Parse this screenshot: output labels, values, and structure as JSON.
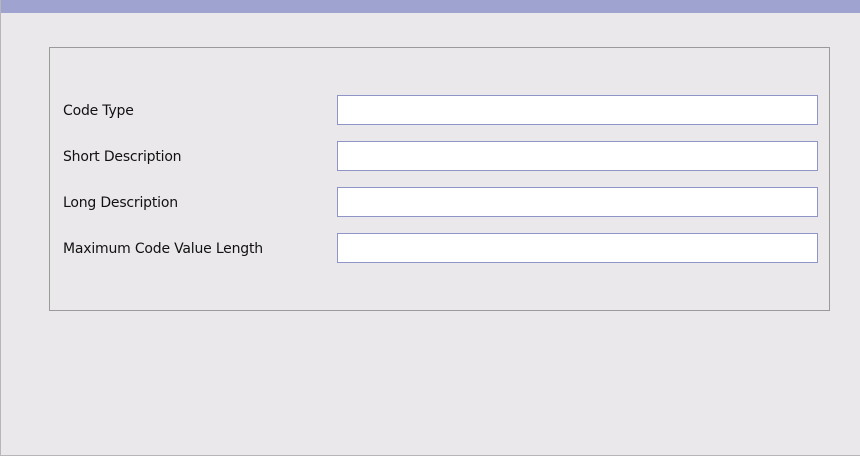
{
  "form": {
    "fields": [
      {
        "label": "Code Type",
        "value": ""
      },
      {
        "label": "Short Description",
        "value": ""
      },
      {
        "label": "Long Description",
        "value": ""
      },
      {
        "label": "Maximum Code Value Length",
        "value": ""
      }
    ]
  },
  "colors": {
    "top_band": "#9ea3d0",
    "background": "#ebe8ec",
    "field_border": "#8f95c7",
    "panel_border": "#9a9a9a"
  }
}
